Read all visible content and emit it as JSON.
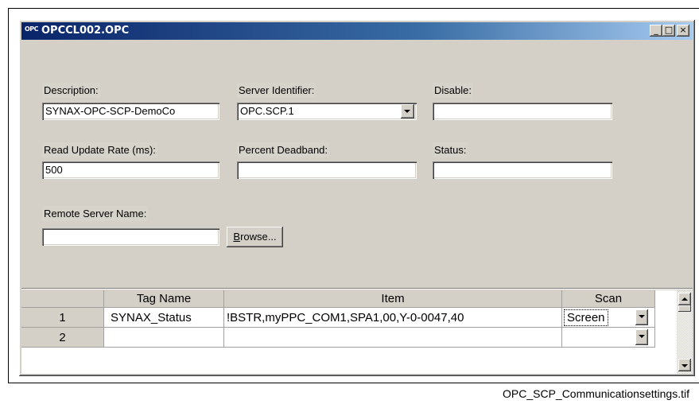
{
  "window": {
    "title": "OPCCL002.OPC",
    "title_logo": "OPC",
    "buttons": {
      "minimize": "_",
      "maximize": "□",
      "close": "×"
    }
  },
  "form": {
    "description": {
      "label": "Description:",
      "value": "SYNAX-OPC-SCP-DemoCo"
    },
    "server_identifier": {
      "label": "Server Identifier:",
      "value": "OPC.SCP.1"
    },
    "disable": {
      "label": "Disable:",
      "value": ""
    },
    "read_update_rate": {
      "label": "Read Update Rate (ms):",
      "value": "500"
    },
    "percent_deadband": {
      "label": "Percent Deadband:",
      "value": ""
    },
    "status": {
      "label": "Status:",
      "value": ""
    },
    "remote_server_name": {
      "label": "Remote Server Name:",
      "value": ""
    },
    "browse_button": {
      "label_underlined": "B",
      "label_rest": "rowse..."
    }
  },
  "table": {
    "columns": [
      "",
      "Tag Name",
      "Item",
      "Scan"
    ],
    "rows": [
      {
        "num": "1",
        "tag_name": "SYNAX_Status",
        "item": "!BSTR,myPPC_COM1,SPA1,00,Y-0-0047,40",
        "scan": "Screen"
      },
      {
        "num": "2",
        "tag_name": "",
        "item": "",
        "scan": ""
      }
    ]
  },
  "caption": "OPC_SCP_Communicationsettings.tif",
  "colors": {
    "title_start": "#0a246a",
    "title_end": "#a6caf0",
    "face": "#d4d0c8"
  }
}
